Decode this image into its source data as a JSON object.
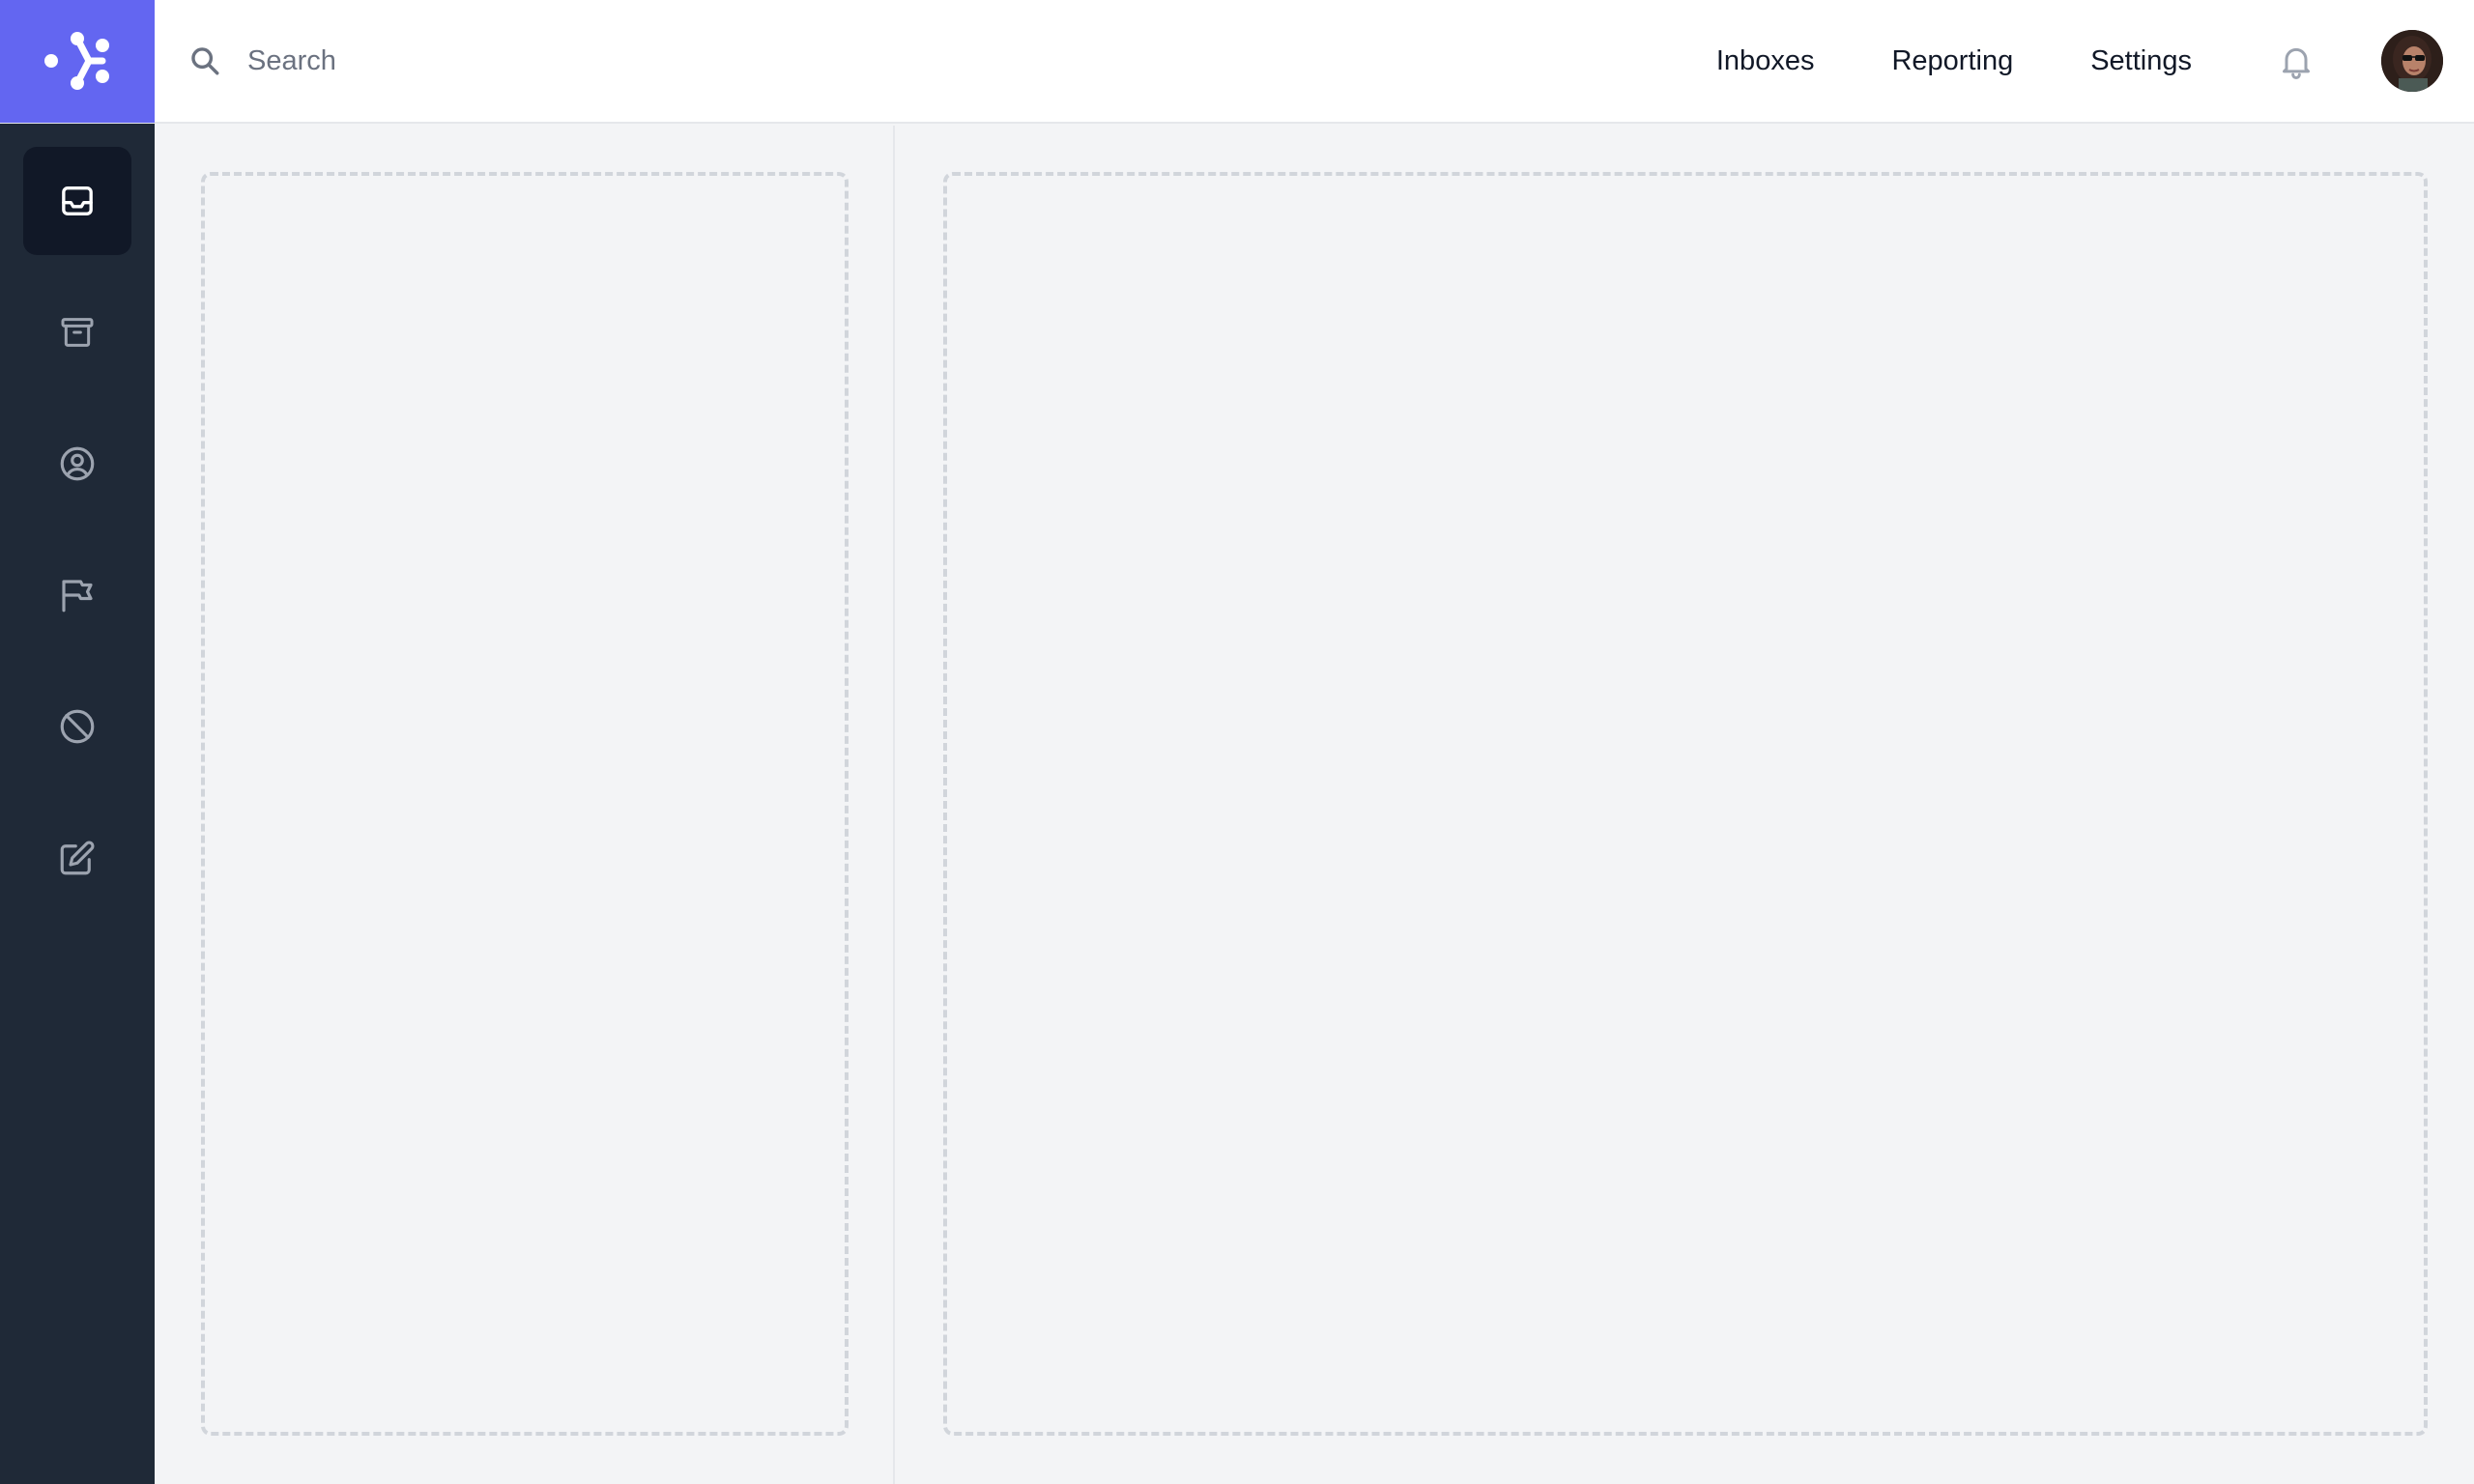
{
  "brand": {
    "logo_icon": "workflow-logo-icon",
    "color": "#6366f1"
  },
  "search": {
    "placeholder": "Search",
    "value": ""
  },
  "nav": {
    "inboxes": "Inboxes",
    "reporting": "Reporting",
    "settings": "Settings"
  },
  "sidebar": {
    "items": [
      {
        "icon": "inbox-icon",
        "active": true
      },
      {
        "icon": "archive-icon",
        "active": false
      },
      {
        "icon": "user-circle-icon",
        "active": false
      },
      {
        "icon": "flag-icon",
        "active": false
      },
      {
        "icon": "ban-icon",
        "active": false
      },
      {
        "icon": "pencil-square-icon",
        "active": false
      }
    ]
  },
  "colors": {
    "sidebar_bg": "#1f2937",
    "sidebar_active_bg": "#111827",
    "page_bg": "#f3f4f6"
  }
}
